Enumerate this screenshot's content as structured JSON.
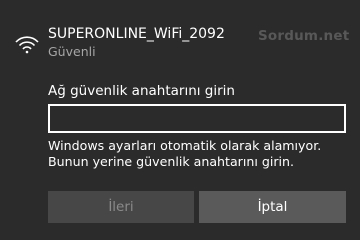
{
  "network": {
    "name": "SUPERONLINE_WiFi_2092",
    "status": "Güvenli",
    "icon": "wifi-secured-icon"
  },
  "watermark": "Sordum.net",
  "security_key": {
    "prompt": "Ağ güvenlik anahtarını girin",
    "value": ""
  },
  "message": {
    "line1": "Windows ayarları otomatik olarak alamıyor.",
    "line2": "Bunun yerine güvenlik anahtarını girin."
  },
  "buttons": {
    "next_label": "İleri",
    "next_enabled": false,
    "cancel_label": "İptal"
  },
  "colors": {
    "background": "#2b2b2b",
    "secondary_text": "#a6a6a6",
    "disabled_button": "#474747",
    "button": "#5a5a5a"
  }
}
